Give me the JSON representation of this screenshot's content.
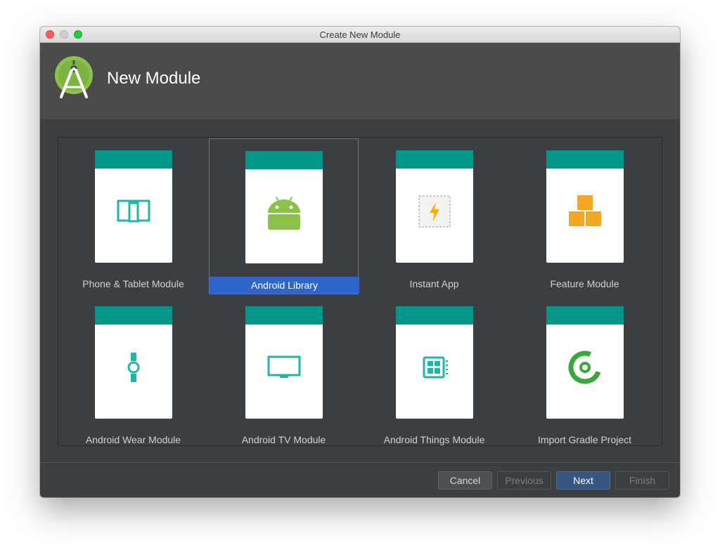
{
  "window": {
    "title": "Create New Module"
  },
  "header": {
    "title": "New Module",
    "logo": "android-studio-logo-icon"
  },
  "templates": [
    {
      "label": "Phone & Tablet Module",
      "icon": "phone-tablet-icon",
      "selected": false
    },
    {
      "label": "Android Library",
      "icon": "android-robot-icon",
      "selected": true
    },
    {
      "label": "Instant App",
      "icon": "instant-app-icon",
      "selected": false
    },
    {
      "label": "Feature Module",
      "icon": "feature-blocks-icon",
      "selected": false
    },
    {
      "label": "Android Wear Module",
      "icon": "wear-watch-icon",
      "selected": false
    },
    {
      "label": "Android TV Module",
      "icon": "tv-icon",
      "selected": false
    },
    {
      "label": "Android Things Module",
      "icon": "things-board-icon",
      "selected": false
    },
    {
      "label": "Import Gradle Project",
      "icon": "gradle-ring-icon",
      "selected": false
    }
  ],
  "buttons": {
    "cancel": "Cancel",
    "previous": "Previous",
    "next": "Next",
    "finish": "Finish"
  },
  "colors": {
    "card_header": "#00968a",
    "selection": "#2f65ca",
    "android_green": "#8bc34a",
    "instant_app_orange": "#ffab00",
    "feature_orange": "#f5a623",
    "gradle_green": "#3da83a"
  }
}
